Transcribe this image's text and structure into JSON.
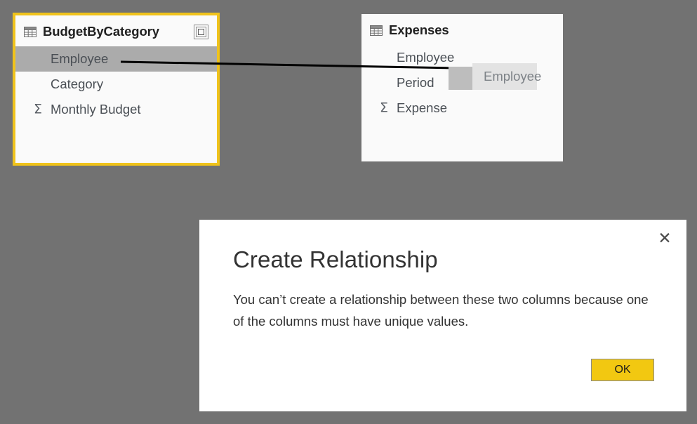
{
  "app": {
    "background_color": "#727272",
    "accent_color": "#f2c811",
    "selection_border_color": "#f0c31b"
  },
  "tables": [
    {
      "name": "BudgetByCategory",
      "selected": true,
      "grid_icon": "table-grid-icon",
      "focus_icon": "focus-mode-icon",
      "fields": [
        {
          "label": "Employee",
          "is_measure": false,
          "highlighted": true
        },
        {
          "label": "Category",
          "is_measure": false,
          "highlighted": false
        },
        {
          "label": "Monthly Budget",
          "is_measure": true,
          "highlighted": false
        }
      ]
    },
    {
      "name": "Expenses",
      "selected": false,
      "grid_icon": "table-grid-icon",
      "fields": [
        {
          "label": "Employee",
          "is_measure": false,
          "highlighted": false
        },
        {
          "label": "Period",
          "is_measure": false,
          "highlighted": false
        },
        {
          "label": "Expense",
          "is_measure": true,
          "highlighted": false
        }
      ]
    }
  ],
  "drag": {
    "ghost_label": "Employee",
    "ghost_bg_color": "#e3e3e3",
    "cursor_block_color": "#bdbdbd",
    "connector_color": "#000000"
  },
  "dialog": {
    "title": "Create Relationship",
    "message": "You can’t create a relationship between these two columns because one of the columns must have unique values.",
    "ok_label": "OK",
    "close_icon": "close-icon",
    "ok_color": "#f2c811"
  },
  "sigma_glyph": "Σ"
}
